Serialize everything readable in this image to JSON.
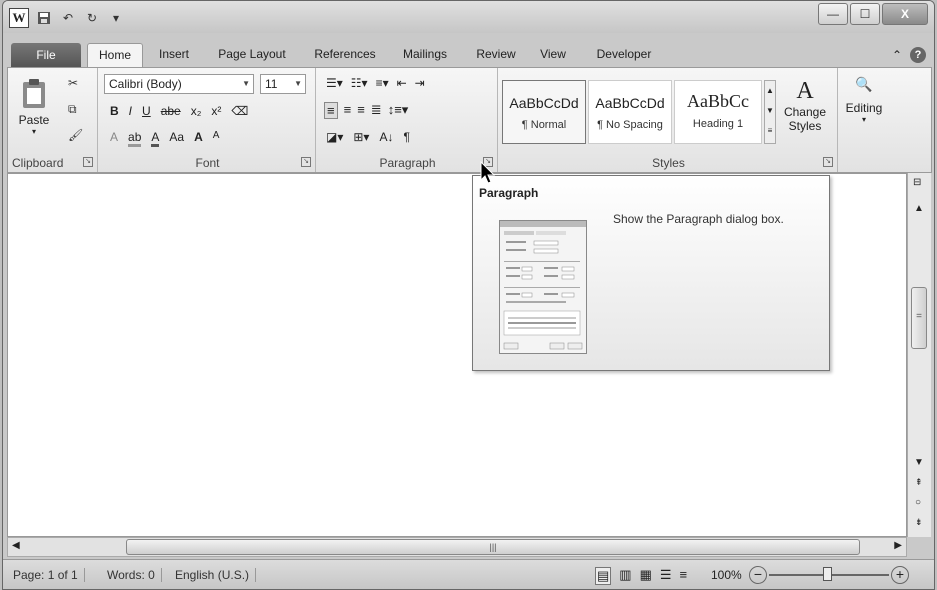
{
  "window": {
    "controls": {
      "minimize": "—",
      "maximize": "☐",
      "close": "X"
    }
  },
  "qat": {
    "logo": "W",
    "undo": "↶",
    "repeat": "↻",
    "more": "▾"
  },
  "tabs": {
    "file": "File",
    "items": [
      "Home",
      "Insert",
      "Page Layout",
      "References",
      "Mailings",
      "Review",
      "View",
      "Developer"
    ],
    "active": "Home"
  },
  "ribbon": {
    "clipboard": {
      "label": "Clipboard",
      "paste": "Paste"
    },
    "font": {
      "label": "Font",
      "family": "Calibri (Body)",
      "size": "11",
      "bold": "B",
      "italic": "I",
      "underline": "U",
      "strike": "abe",
      "subscript": "x₂",
      "superscript": "x²",
      "text_effects": "A",
      "highlight": "ab",
      "font_color": "A",
      "change_case": "Aa",
      "grow": "A",
      "shrink": "A"
    },
    "paragraph": {
      "label": "Paragraph",
      "pilcrow": "¶",
      "sort": "A↓"
    },
    "styles": {
      "label": "Styles",
      "items": [
        {
          "preview": "AaBbCcDd",
          "name": "¶ Normal"
        },
        {
          "preview": "AaBbCcDd",
          "name": "¶ No Spacing"
        },
        {
          "preview": "AaBbCc",
          "name": "Heading 1"
        }
      ],
      "change_styles": "Change",
      "change_styles2": "Styles"
    },
    "editing": {
      "label": "Editing"
    }
  },
  "tooltip": {
    "title": "Paragraph",
    "description": "Show the Paragraph dialog box."
  },
  "status": {
    "page": "Page: 1 of 1",
    "words": "Words: 0",
    "language": "English (U.S.)",
    "zoom": "100%"
  }
}
